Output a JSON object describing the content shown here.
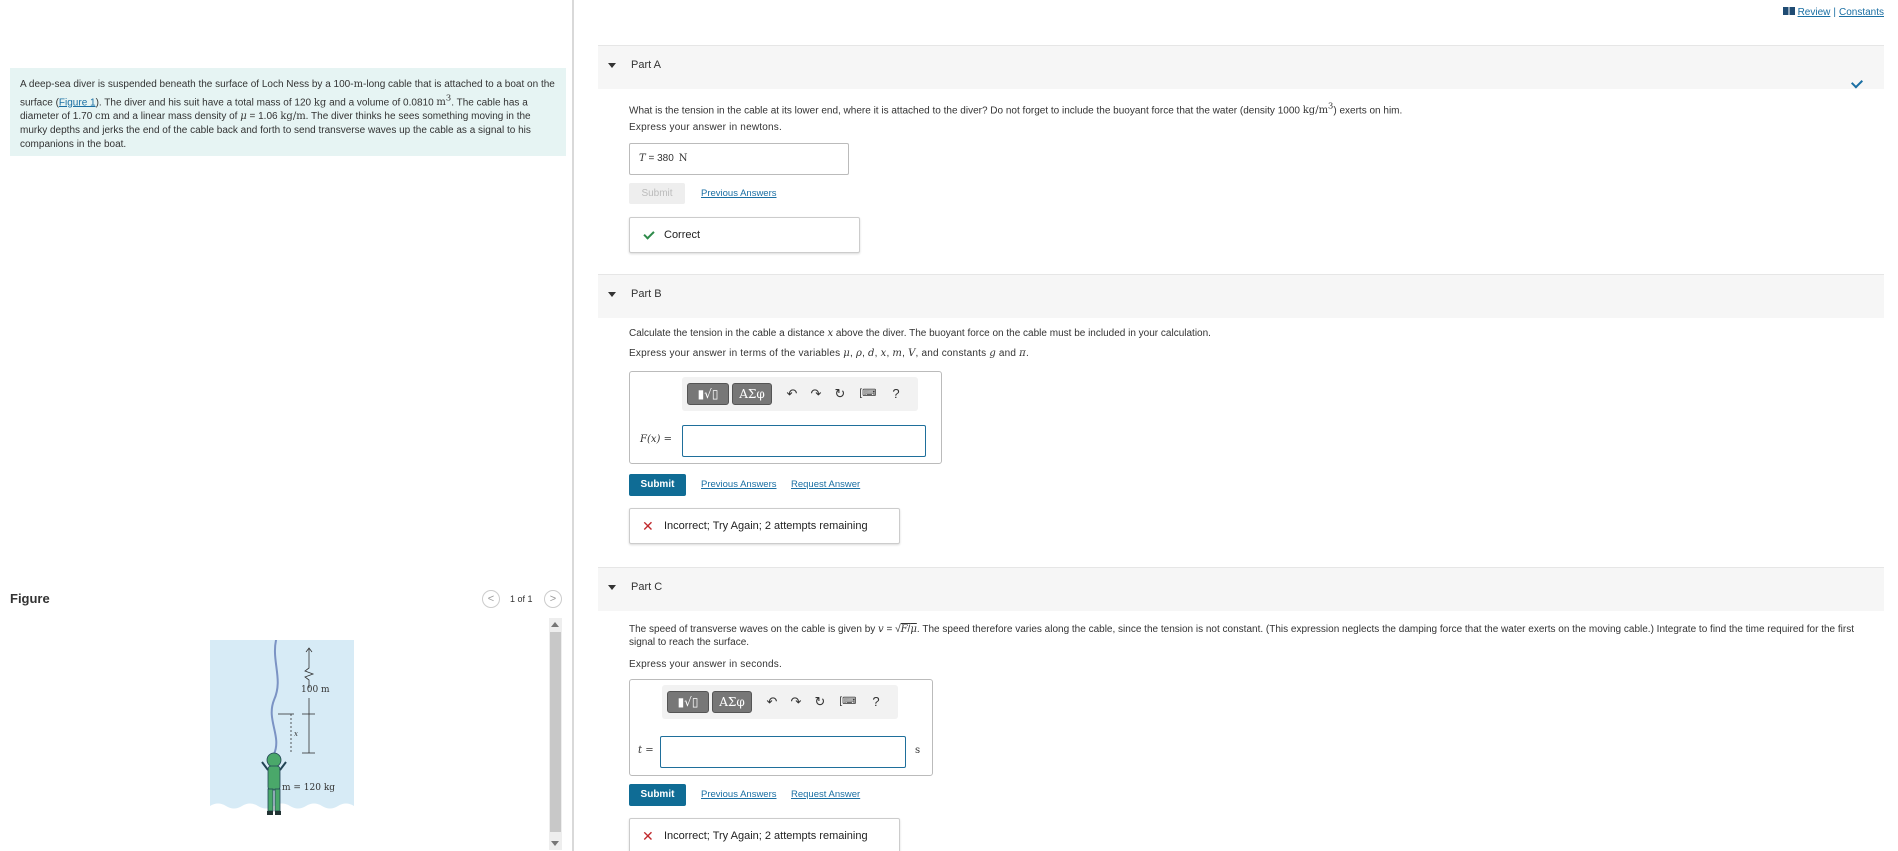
{
  "header": {
    "review_label": "Review",
    "separator": "|",
    "constants_label": "Constants"
  },
  "problem": {
    "text_html": "A deep-sea diver is suspended beneath the surface of Loch Ness by a 100-<b class='u'>m</b>-long cable that is attached to a boat on the surface (<a href='#'>Figure 1</a>). The diver and his suit have a total mass of 120 <b class='u'>kg</b> and a volume of 0.0810 <b class='u'>m<sup>3</sup></b>. The cable has a diameter of 1.70 <b class='u'>cm</b> and a linear mass density of <i>μ</i> = 1.06 <b class='u'>kg/m</b>. The diver thinks he sees something moving in the murky depths and jerks the end of the cable back and forth to send transverse waves up the cable as a signal to his companions in the boat."
  },
  "figure": {
    "title": "Figure",
    "count": "1 of 1",
    "length_label": "100 m",
    "x_label": "x",
    "mass_label": "m = 120 kg"
  },
  "partA": {
    "title": "Part A",
    "question_html": "What is the tension in the cable at its lower end, where it is attached to the diver? Do not forget to include the buoyant force that the water (density 1000 <b style='font-family:DejaVu Serif,serif;font-weight:normal'>kg/m<sup>3</sup></b>) exerts on him.",
    "express": "Express your answer in newtons.",
    "answer_var": "T",
    "answer_eq": " = ",
    "answer_value": "380",
    "answer_unit": "N",
    "submit_label": "Submit",
    "previous_answers": "Previous Answers",
    "feedback": "Correct"
  },
  "partB": {
    "title": "Part B",
    "question_html": "Calculate the tension in the cable a distance <i>x</i> above the diver. The buoyant force on the cable must be included in your calculation.",
    "express_html": "Express your answer in terms of the variables <i>μ</i>, <i>ρ</i>, <i>d</i>, <i>x</i>, <i>m</i>, <i>V</i>, and constants <i>g</i> and <i>π</i>.",
    "label_html": "F(x) <span class='n'>=</span>",
    "submit_label": "Submit",
    "previous_answers": "Previous Answers",
    "request_answer": "Request Answer",
    "feedback": "Incorrect; Try Again; 2 attempts remaining"
  },
  "partC": {
    "title": "Part C",
    "question_html": "The speed of transverse waves on the cable is given by <i>v</i> = √<span style='text-decoration:overline'><i>F</i>/<i>μ</i></span>. The speed therefore varies along the cable, since the tension is not constant. (This expression neglects the damping force that the water exerts on the moving cable.) Integrate to find the time required for the first signal to reach the surface.",
    "express": "Express your answer in seconds.",
    "label_html": "t <span class='n'>=</span>",
    "unit": "s",
    "submit_label": "Submit",
    "previous_answers": "Previous Answers",
    "request_answer": "Request Answer",
    "feedback": "Incorrect; Try Again; 2 attempts remaining"
  },
  "toolbar": {
    "template_glyph": "▮√▯",
    "greek_glyph": "ΑΣφ",
    "undo_glyph": "↶",
    "redo_glyph": "↷",
    "reset_glyph": "↻",
    "keyboard_glyph": "[⌨",
    "help_glyph": "?"
  },
  "colors": {
    "accent": "#0f6c95",
    "link": "#1a6fa3",
    "problem_bg": "#e6f4f3",
    "correct": "#2e8b4a",
    "incorrect": "#c0282c"
  }
}
